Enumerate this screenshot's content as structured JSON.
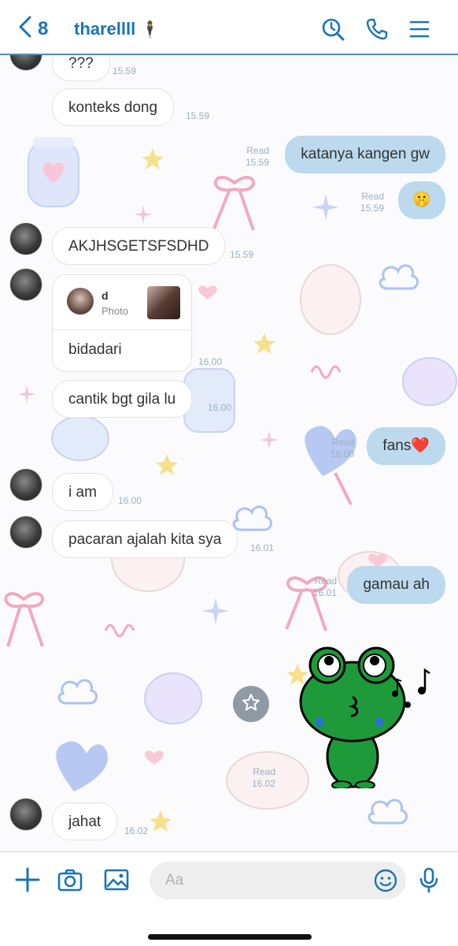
{
  "header": {
    "back_count": "8",
    "contact_name": "tharellll",
    "contact_emoji": "🕴"
  },
  "messages": [
    {
      "side": "in",
      "text": "???",
      "time": "15.59"
    },
    {
      "side": "in",
      "text": "konteks dong",
      "time": "15.59"
    },
    {
      "side": "out",
      "text": "katanya kangen gw",
      "read": "Read",
      "time": "15.59"
    },
    {
      "side": "out",
      "text": "🤫",
      "read": "Read",
      "time": "15.59"
    },
    {
      "side": "in",
      "text": "AKJHSGETSFSDHD",
      "time": "15.59"
    },
    {
      "side": "in",
      "type": "reply",
      "reply_name": "d",
      "reply_sub": "Photo",
      "text": "bidadari",
      "time": "16.00"
    },
    {
      "side": "in",
      "text": "cantik bgt gila lu",
      "time": "16.00"
    },
    {
      "side": "out",
      "text": "fans❤️",
      "read": "Read",
      "time": "16.00"
    },
    {
      "side": "in",
      "text": "i am",
      "time": "16.00"
    },
    {
      "side": "in",
      "text": "pacaran ajalah kita sya",
      "time": "16.01"
    },
    {
      "side": "out",
      "text": "gamau ah",
      "read": "Read",
      "time": "16.01"
    },
    {
      "side": "out",
      "type": "sticker",
      "sticker": "green-frog-whistling",
      "read": "Read",
      "time": "16.02"
    },
    {
      "side": "in",
      "text": "jahat",
      "time": "16.02"
    }
  ],
  "footer": {
    "input_placeholder": "Aa",
    "input_value": ""
  },
  "colors": {
    "accent": "#1a73b8",
    "out_bubble": "#bcd9ee",
    "in_bubble": "#ffffff"
  },
  "icons": [
    "back-chevron-icon",
    "search-icon",
    "phone-icon",
    "menu-icon",
    "plus-icon",
    "camera-icon",
    "image-icon",
    "emoji-icon",
    "microphone-icon",
    "star-icon"
  ]
}
